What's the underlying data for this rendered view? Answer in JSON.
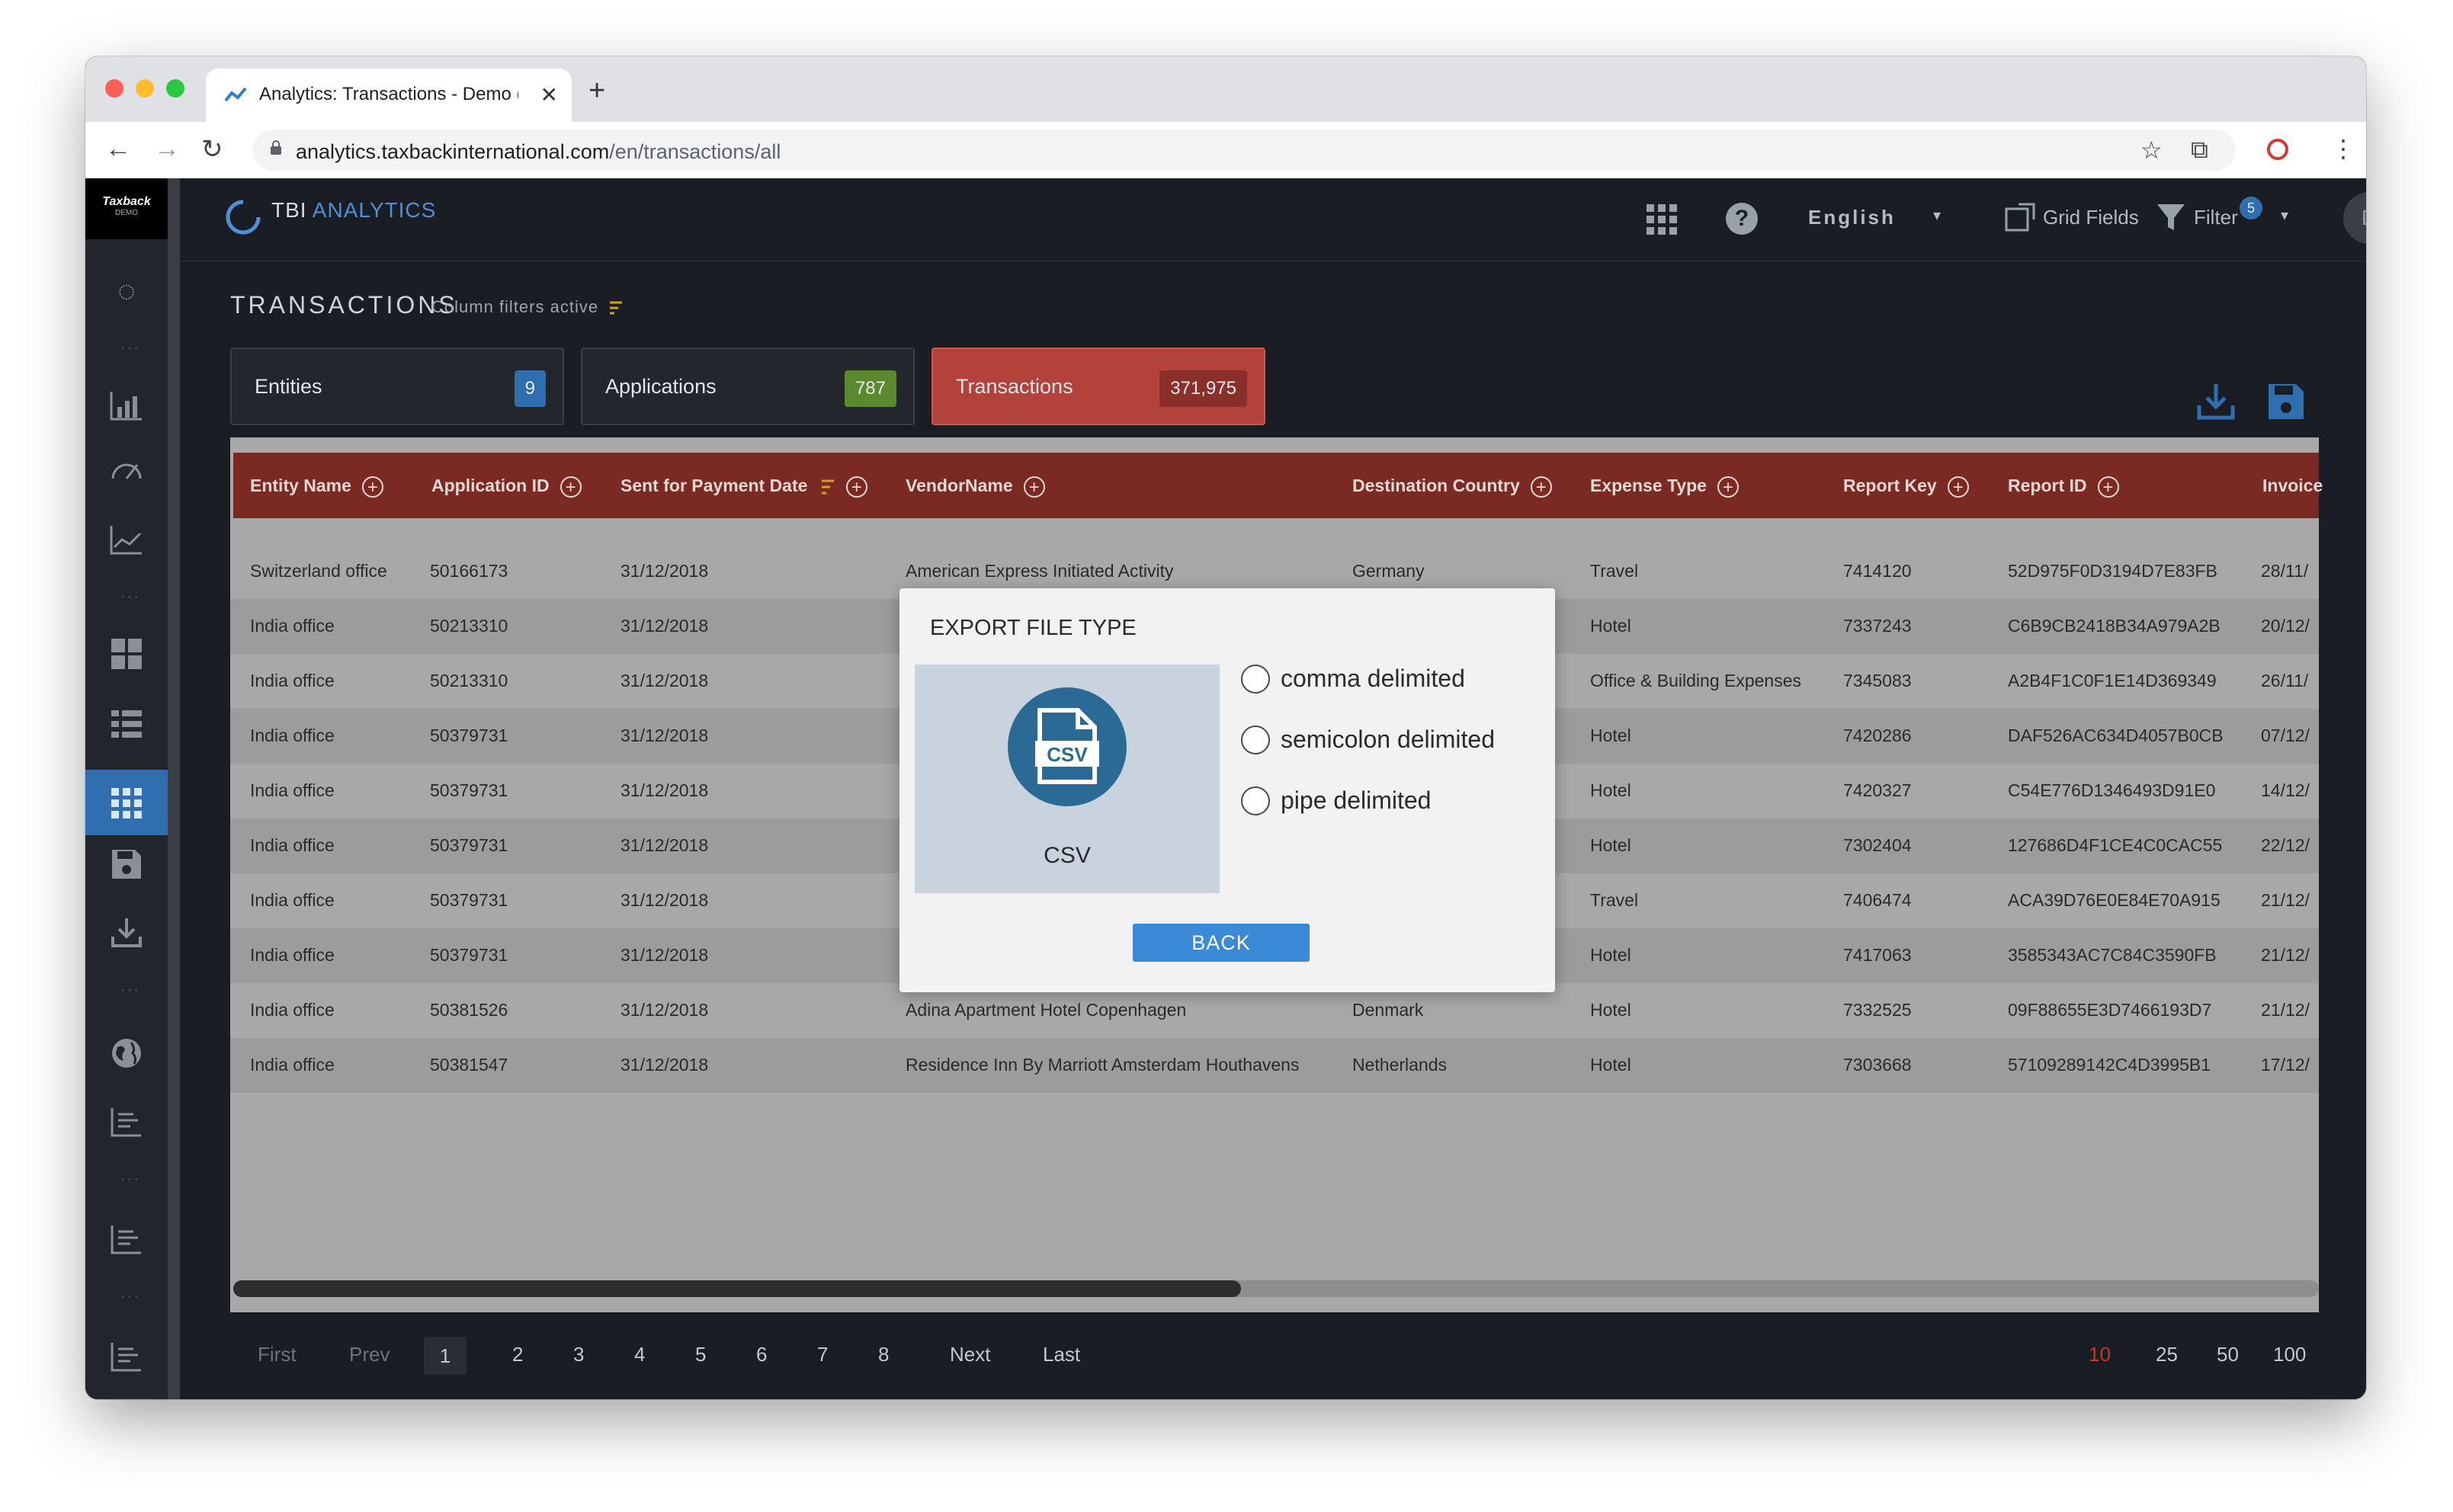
{
  "browser": {
    "tab_title": "Analytics: Transactions - Demo (",
    "url_host": "analytics.taxbackinternational.com",
    "url_path": "/en/transactions/all"
  },
  "sidebar": {
    "logo_text": "Taxback",
    "logo_sub": "DEMO"
  },
  "header": {
    "brand_name": "TBI",
    "brand_accent": "ANALYTICS",
    "language": "English",
    "grid_fields": "Grid Fields",
    "filter_label": "Filter",
    "filter_count": "5",
    "avatar_initial": "D"
  },
  "page": {
    "title": "TRANSACTIONS",
    "filters_note": "Column filters active"
  },
  "cards": [
    {
      "label": "Entities",
      "count": "9",
      "color": "#2f6fb0"
    },
    {
      "label": "Applications",
      "count": "787",
      "color": "#5b8a2e"
    },
    {
      "label": "Transactions",
      "count": "371,975",
      "color": "#b3433a"
    }
  ],
  "table": {
    "columns": [
      "Entity Name",
      "Application ID",
      "Sent for Payment Date",
      "VendorName",
      "Destination Country",
      "Expense Type",
      "Report Key",
      "Report ID",
      "Invoice"
    ],
    "rows": [
      [
        "Switzerland office",
        "50166173",
        "31/12/2018",
        "American Express Initiated Activity",
        "Germany",
        "Travel",
        "7414120",
        "52D975F0D3194D7E83FB",
        "28/11/"
      ],
      [
        "India office",
        "50213310",
        "31/12/2018",
        "",
        "",
        "Hotel",
        "7337243",
        "C6B9CB2418B34A979A2B",
        "20/12/"
      ],
      [
        "India office",
        "50213310",
        "31/12/2018",
        "",
        "",
        "Office & Building Expenses",
        "7345083",
        "A2B4F1C0F1E14D369349",
        "26/11/"
      ],
      [
        "India office",
        "50379731",
        "31/12/2018",
        "",
        "",
        "Hotel",
        "7420286",
        "DAF526AC634D4057B0CB",
        "07/12/"
      ],
      [
        "India office",
        "50379731",
        "31/12/2018",
        "",
        "",
        "Hotel",
        "7420327",
        "C54E776D1346493D91E0",
        "14/12/"
      ],
      [
        "India office",
        "50379731",
        "31/12/2018",
        "",
        "",
        "Hotel",
        "7302404",
        "127686D4F1CE4C0CAC55",
        "22/12/"
      ],
      [
        "India office",
        "50379731",
        "31/12/2018",
        "",
        "",
        "Travel",
        "7406474",
        "ACA39D76E0E84E70A915",
        "21/12/"
      ],
      [
        "India office",
        "50379731",
        "31/12/2018",
        "",
        "",
        "Hotel",
        "7417063",
        "3585343AC7C84C3590FB",
        "21/12/"
      ],
      [
        "India office",
        "50381526",
        "31/12/2018",
        "Adina Apartment Hotel Copenhagen",
        "Denmark",
        "Hotel",
        "7332525",
        "09F88655E3D7466193D7",
        "21/12/"
      ],
      [
        "India office",
        "50381547",
        "31/12/2018",
        "Residence Inn By Marriott Amsterdam Houthavens",
        "Netherlands",
        "Hotel",
        "7303668",
        "57109289142C4D3995B1",
        "17/12/"
      ]
    ]
  },
  "pagination": {
    "first": "First",
    "prev": "Prev",
    "current": "1",
    "pages": [
      "2",
      "3",
      "4",
      "5",
      "6",
      "7",
      "8"
    ],
    "next": "Next",
    "last": "Last",
    "sizes": [
      "10",
      "25",
      "50",
      "100"
    ],
    "active_size_color": "#c0392b"
  },
  "modal": {
    "title": "EXPORT FILE TYPE",
    "file_type": "CSV",
    "icon_text": "CSV",
    "options": [
      "comma delimited",
      "semicolon delimited",
      "pipe delimited"
    ],
    "back": "BACK"
  }
}
